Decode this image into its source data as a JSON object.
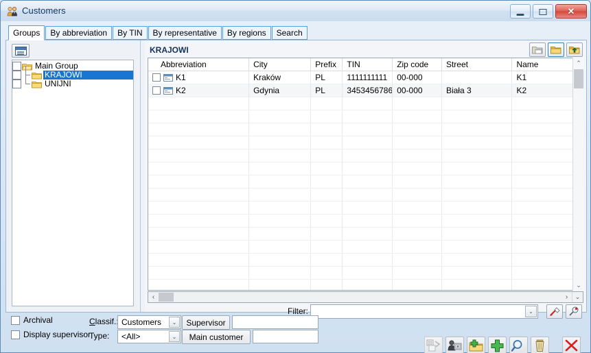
{
  "window": {
    "title": "Customers",
    "icon": "customers-icon",
    "minimize_label": "Minimize",
    "maximize_label": "Maximize",
    "close_label": "Close",
    "close_glyph": "✕"
  },
  "tabs": [
    {
      "label": "Groups",
      "active": true
    },
    {
      "label": "By abbreviation",
      "active": false
    },
    {
      "label": "By TIN",
      "active": false
    },
    {
      "label": "By representative",
      "active": false
    },
    {
      "label": "By regions",
      "active": false
    },
    {
      "label": "Search",
      "active": false
    }
  ],
  "tree": {
    "toolbar_button": "panel-toggle-icon",
    "nodes": [
      {
        "label": "Main Group",
        "level": 0,
        "selected": false,
        "icon": "folder-open-icon"
      },
      {
        "label": "KRAJOWI",
        "level": 1,
        "selected": true,
        "icon": "folder-icon"
      },
      {
        "label": "UNIJNI",
        "level": 1,
        "selected": false,
        "icon": "folder-icon"
      }
    ]
  },
  "list": {
    "group_title": "KRAJOWI",
    "folder_buttons": [
      {
        "name": "open-folder-icon",
        "selected": false,
        "disabled": true
      },
      {
        "name": "folder-icon",
        "selected": true,
        "disabled": false
      },
      {
        "name": "folder-up-icon",
        "selected": false,
        "disabled": false
      }
    ],
    "columns": [
      "Abbreviation",
      "City",
      "Prefix",
      "TIN",
      "Zip code",
      "Street",
      "Name"
    ],
    "rows": [
      {
        "checked": false,
        "Abbreviation": "K1",
        "City": "Kraków",
        "Prefix": "PL",
        "TIN": "1111111111",
        "Zip code": "00-000",
        "Street": "",
        "Name": "K1"
      },
      {
        "checked": false,
        "Abbreviation": "K2",
        "City": "Gdynia",
        "Prefix": "PL",
        "TIN": "3453456786",
        "Zip code": "00-000",
        "Street": "Biała 3",
        "Name": "K2"
      }
    ],
    "scroll": {
      "up_arrow": "⌃",
      "down_arrow": "⌄",
      "left_arrow": "‹",
      "right_arrow": "›",
      "corner_arrow": "⌄"
    }
  },
  "filter": {
    "label": "Filter:",
    "value": "",
    "placeholder": "",
    "dropdown_arrow": "⌄",
    "clear_filter_icon": "clear-filter-icon",
    "filter_settings_icon": "filter-settings-icon"
  },
  "bottom": {
    "archival": {
      "label": "Archival",
      "checked": false
    },
    "display_supervisor": {
      "label": "Display supervisor",
      "checked": false
    },
    "classif": {
      "label_prefix": "",
      "label_accel": "C",
      "label_rest": "lassif.:",
      "value": "Customers",
      "arrow": "⌄"
    },
    "type": {
      "label": "Type:",
      "value": "<All>",
      "arrow": "⌄"
    },
    "supervisor": {
      "button": "Supervisor",
      "value": ""
    },
    "main_customer": {
      "button": "Main customer",
      "value": ""
    },
    "actions": [
      {
        "name": "report-icon",
        "title": "Reports",
        "disabled": true
      },
      {
        "name": "representative-icon",
        "title": "Representative",
        "disabled": false
      },
      {
        "name": "add-folder-icon",
        "title": "Add group",
        "disabled": false
      },
      {
        "name": "add-icon",
        "title": "Add",
        "disabled": false
      },
      {
        "name": "search-icon",
        "title": "Search",
        "disabled": false
      },
      {
        "name": "delete-icon",
        "title": "Delete",
        "disabled": false
      }
    ],
    "close_action": {
      "name": "close-window-icon",
      "title": "Close"
    }
  },
  "colors": {
    "accent": "#1876d2",
    "tab_border": "#55a0dd",
    "title_text": "#11335c",
    "close_red": "#d2493e",
    "folder_yellow": "#f0c040"
  }
}
